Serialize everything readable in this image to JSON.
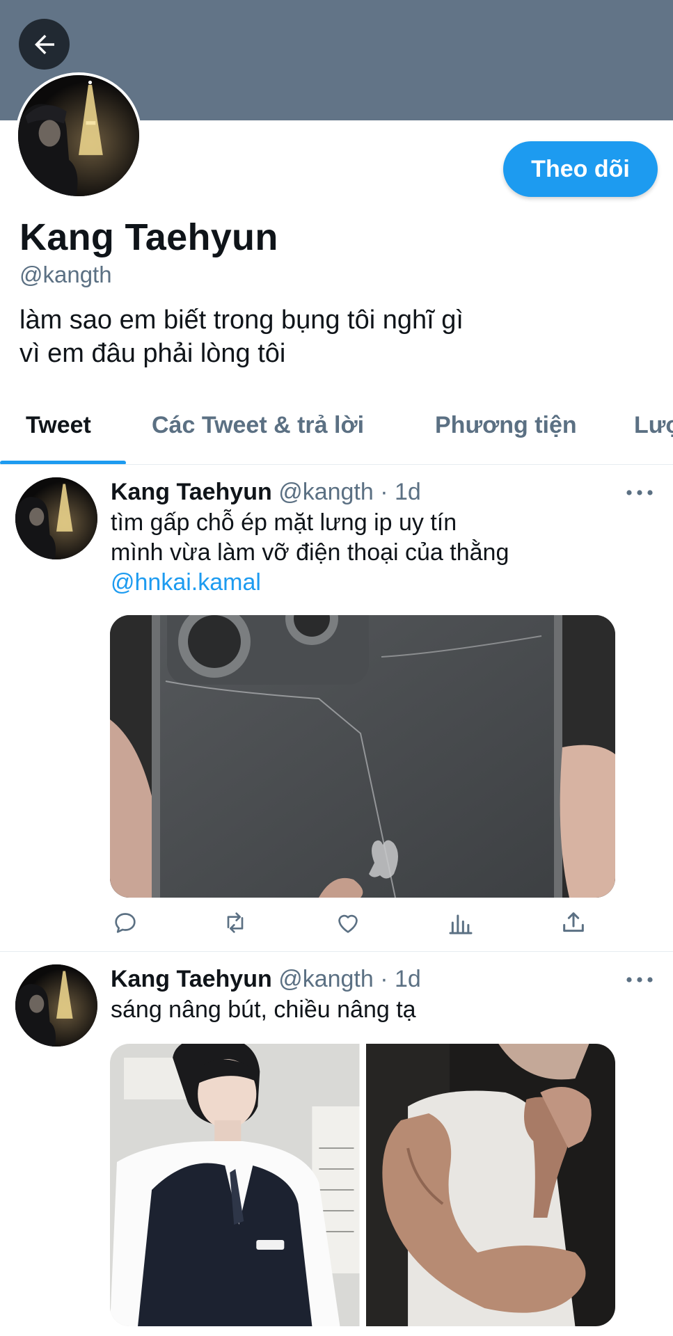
{
  "header": {
    "back_icon": "arrow-left-icon",
    "banner_color": "#627487"
  },
  "profile": {
    "display_name": "Kang Taehyun",
    "handle": "@kangth",
    "follow_label": "Theo dõi",
    "bio_lines": [
      "làm sao em biết trong bụng tôi nghĩ gì",
      "vì em đâu phải lòng tôi"
    ]
  },
  "tabs": [
    {
      "label": "Tweet",
      "active": true
    },
    {
      "label": "Các Tweet & trả lời",
      "active": false
    },
    {
      "label": "Phương tiện",
      "active": false
    },
    {
      "label": "Lượ",
      "active": false
    }
  ],
  "tweets": [
    {
      "name": "Kang Taehyun",
      "meta": "@kangth · 1d",
      "lines": [
        "tìm gấp chỗ ép mặt lưng ip uy tín",
        "mình vừa làm vỡ điện thoại của thằng"
      ],
      "mention": "@hnkai.kamal"
    },
    {
      "name": "Kang Taehyun",
      "meta": "@kangth · 1d",
      "lines": [
        "sáng nâng bút, chiều nâng tạ"
      ]
    }
  ],
  "actions": [
    "reply-icon",
    "retweet-icon",
    "like-icon",
    "analytics-icon",
    "share-icon"
  ],
  "colors": {
    "accent": "#1d9bf0",
    "secondary_text": "#5b7083",
    "primary_text": "#0f1419"
  }
}
